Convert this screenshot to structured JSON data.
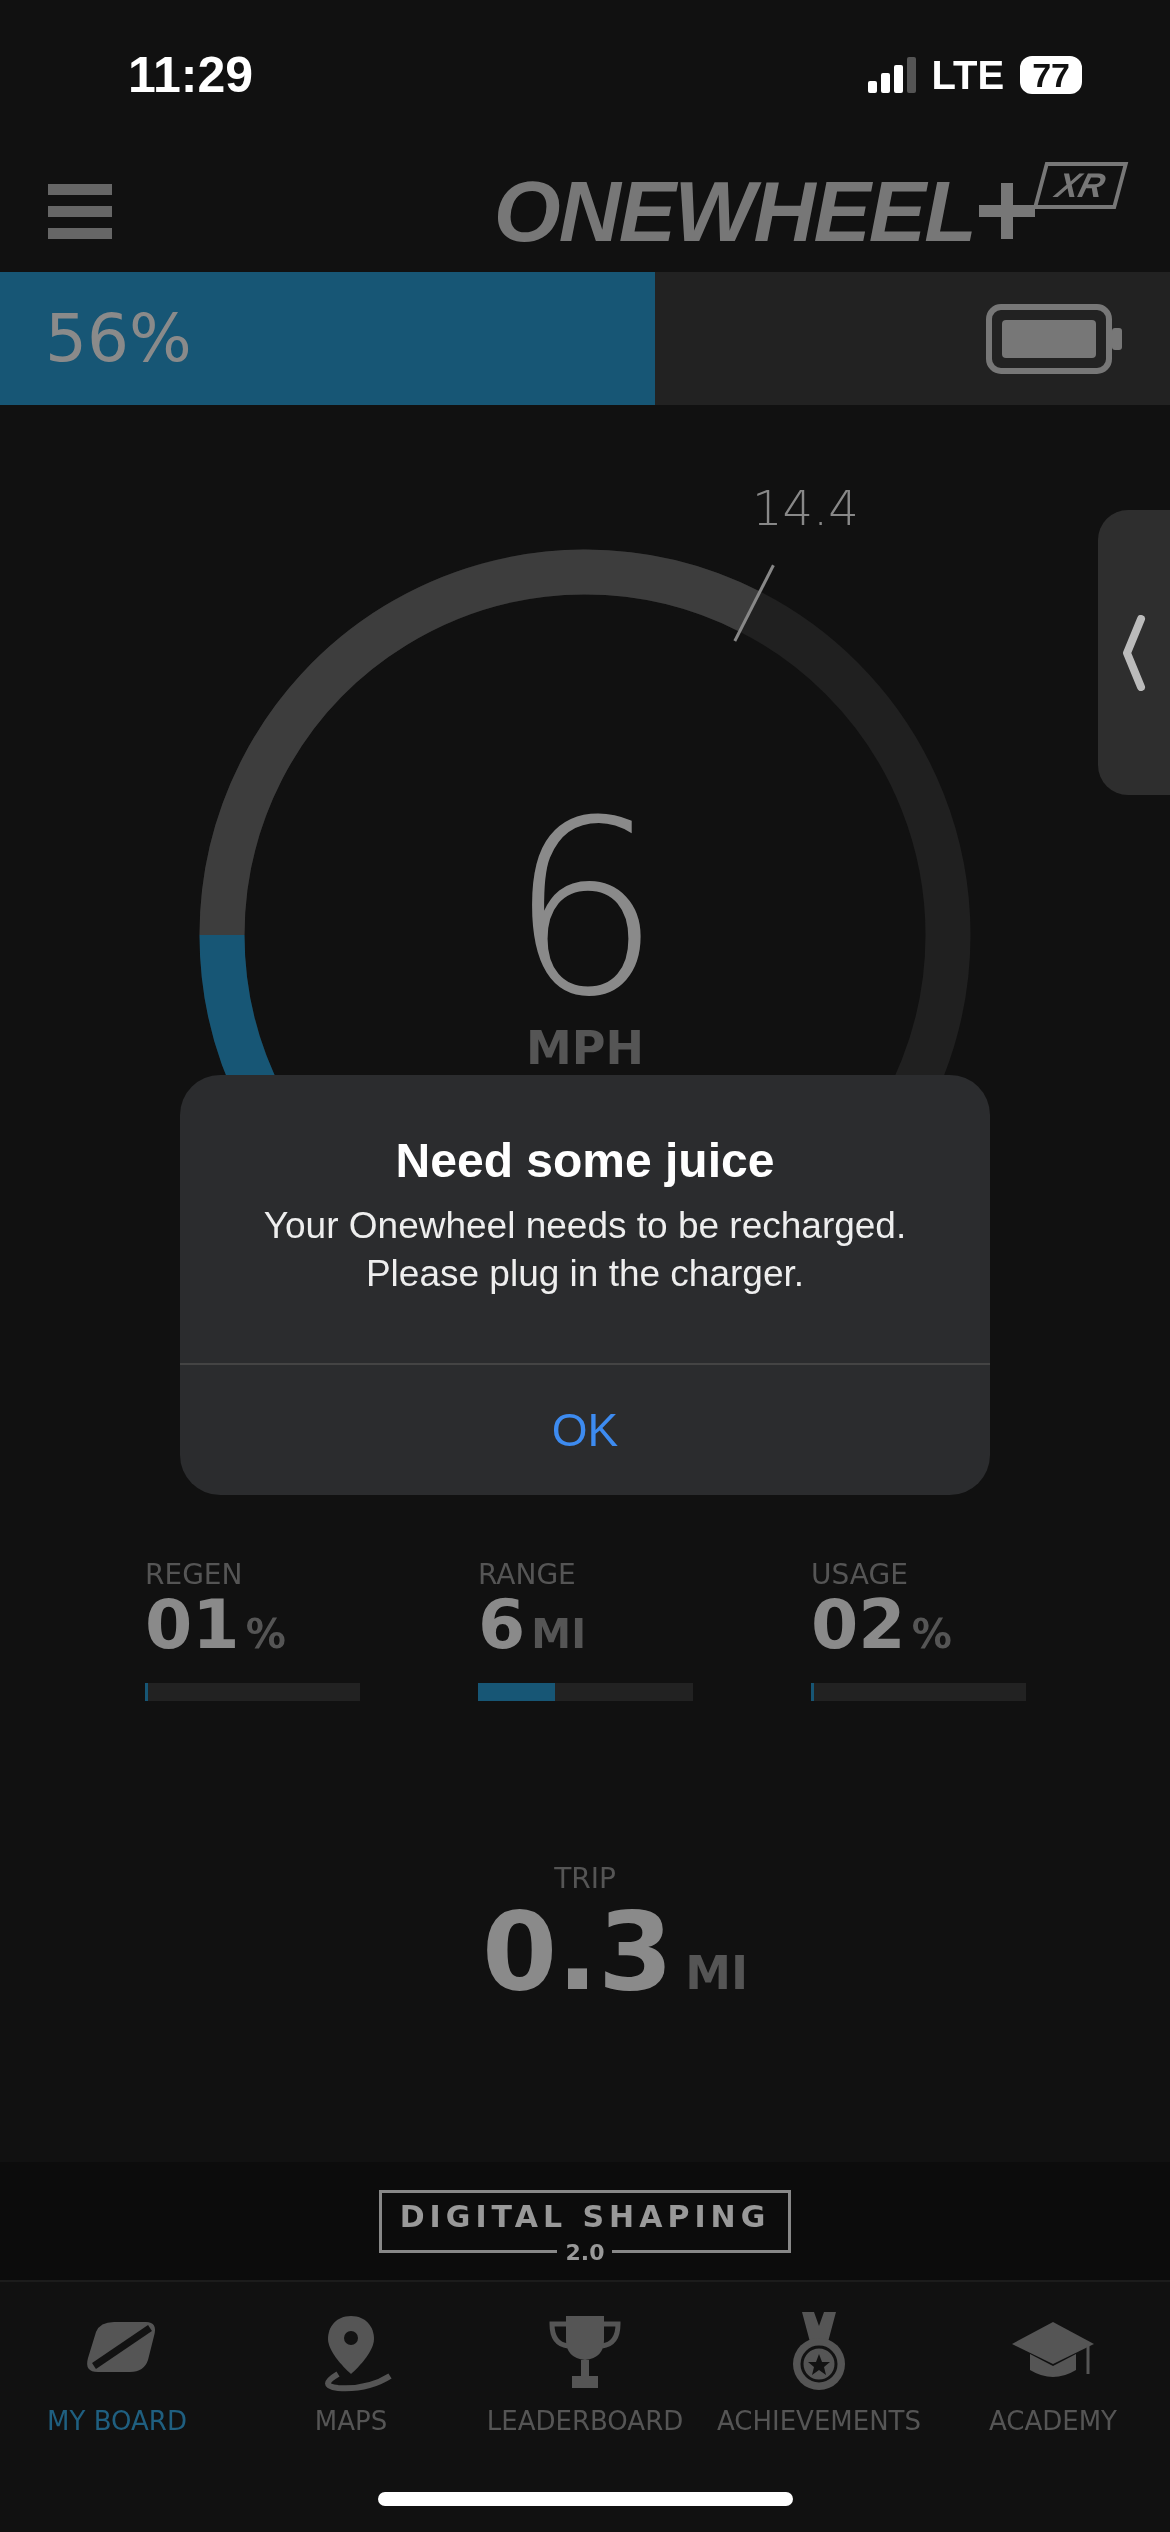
{
  "status_bar": {
    "time": "11:29",
    "network": "LTE",
    "battery": "77"
  },
  "header": {
    "logo": "ONEWHEEL",
    "logo_badge": "XR"
  },
  "battery": {
    "reading": "56%",
    "level": 0.56
  },
  "gauge": {
    "top_speed": "14.4",
    "speed": "6",
    "unit": "MPH"
  },
  "alert": {
    "title": "Need some juice",
    "message": "Your Onewheel needs to be recharged. Please plug in the charger.",
    "button": "OK"
  },
  "stats": [
    {
      "label": "REGEN",
      "value": "01",
      "unit": "%",
      "level": 0.01
    },
    {
      "label": "RANGE",
      "value": "6",
      "unit": "MI",
      "level": 0.36
    },
    {
      "label": "USAGE",
      "value": "02",
      "unit": "%",
      "level": 0.01
    }
  ],
  "trip": {
    "label": "TRIP",
    "value": "0.3",
    "unit": "MI"
  },
  "banner": {
    "title": "DIGITAL SHAPING",
    "version": "2.0"
  },
  "tabs": [
    {
      "label": "MY BOARD",
      "selected": true
    },
    {
      "label": "MAPS",
      "selected": false
    },
    {
      "label": "LEADERBOARD",
      "selected": false
    },
    {
      "label": "ACHIEVEMENTS",
      "selected": false
    },
    {
      "label": "ACADEMY",
      "selected": false
    }
  ]
}
